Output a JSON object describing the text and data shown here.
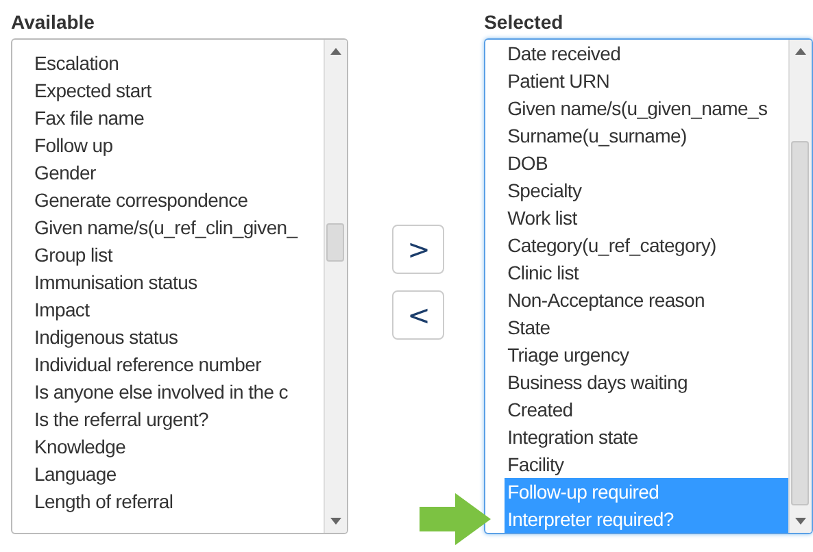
{
  "available": {
    "label": "Available",
    "items": [
      {
        "text": "Escalation",
        "selected": false
      },
      {
        "text": "Expected start",
        "selected": false
      },
      {
        "text": "Fax file name",
        "selected": false
      },
      {
        "text": "Follow up",
        "selected": false
      },
      {
        "text": "Gender",
        "selected": false
      },
      {
        "text": "Generate correspondence",
        "selected": false
      },
      {
        "text": "Given name/s(u_ref_clin_given_",
        "selected": false
      },
      {
        "text": "Group list",
        "selected": false
      },
      {
        "text": "Immunisation status",
        "selected": false
      },
      {
        "text": "Impact",
        "selected": false
      },
      {
        "text": "Indigenous status",
        "selected": false
      },
      {
        "text": "Individual reference number",
        "selected": false
      },
      {
        "text": "Is anyone else involved in the c",
        "selected": false
      },
      {
        "text": "Is the referral urgent?",
        "selected": false
      },
      {
        "text": "Knowledge",
        "selected": false
      },
      {
        "text": "Language",
        "selected": false
      },
      {
        "text": "Length of referral",
        "selected": false
      }
    ]
  },
  "buttons": [
    ">",
    "<"
  ],
  "selected": {
    "label": "Selected",
    "items": [
      {
        "text": "Date received",
        "selected": false
      },
      {
        "text": "Patient URN",
        "selected": false
      },
      {
        "text": "Given name/s(u_given_name_s",
        "selected": false
      },
      {
        "text": "Surname(u_surname)",
        "selected": false
      },
      {
        "text": "DOB",
        "selected": false
      },
      {
        "text": "Specialty",
        "selected": false
      },
      {
        "text": "Work list",
        "selected": false
      },
      {
        "text": "Category(u_ref_category)",
        "selected": false
      },
      {
        "text": "Clinic list",
        "selected": false
      },
      {
        "text": "Non-Acceptance reason",
        "selected": false
      },
      {
        "text": "State",
        "selected": false
      },
      {
        "text": "Triage urgency",
        "selected": false
      },
      {
        "text": "Business days waiting",
        "selected": false
      },
      {
        "text": "Created",
        "selected": false
      },
      {
        "text": "Integration state",
        "selected": false
      },
      {
        "text": "Facility",
        "selected": false
      },
      {
        "text": "Follow-up required",
        "selected": true
      },
      {
        "text": "Interpreter required?",
        "selected": true
      }
    ]
  }
}
